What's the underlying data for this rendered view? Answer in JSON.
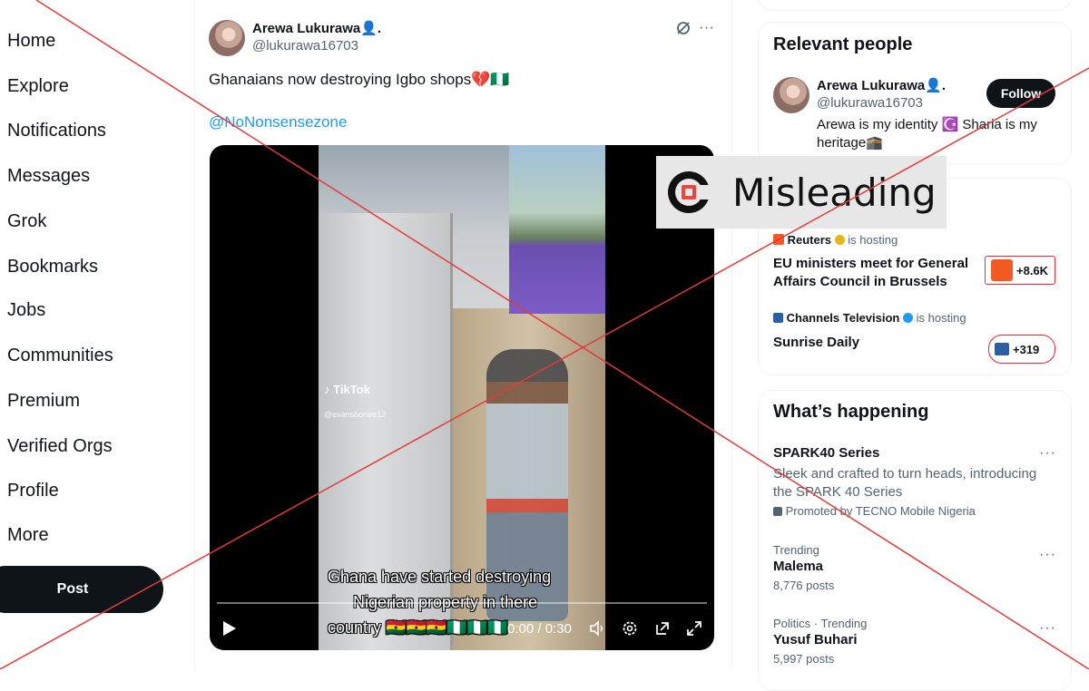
{
  "nav": {
    "items": [
      "Home",
      "Explore",
      "Notifications",
      "Messages",
      "Grok",
      "Bookmarks",
      "Jobs",
      "Communities",
      "Premium",
      "Verified Orgs",
      "Profile",
      "More"
    ],
    "post_label": "Post"
  },
  "tweet": {
    "author_name": "Arewa Lukurawa👤.",
    "author_handle": "@lukurawa16703",
    "text": "Ghanaians  now destroying Igbo shops💔🇳🇬",
    "mention": "@NoNonsensezone",
    "video": {
      "watermark": "TikTok",
      "watermark_user": "@evansbonee12",
      "caption_lines": [
        "Ghana have started destroying",
        "Nigerian property in there",
        "country 🇬🇭🇬🇭🇬🇭🇳🇬🇳🇬🇳🇬"
      ],
      "time": "0:00 / 0:30",
      "progress": 0
    }
  },
  "relevant": {
    "title": "Relevant people",
    "name": "Arewa Lukurawa👤.",
    "handle": "@lukurawa16703",
    "follow_label": "Follow",
    "bio_line1": "Arewa is my identity ☪️ Sharia is my",
    "bio_line2": "heritage🕋"
  },
  "spaces": [
    {
      "host": "Reuters",
      "hosting": "is hosting",
      "title_line1": "EU ministers meet for General",
      "title_line2": "Affairs Council in Brussels",
      "count": "+8.6K"
    },
    {
      "host": "Channels Television",
      "hosting": "is hosting",
      "title_line1": "Sunrise Daily",
      "title_line2": "",
      "count": "+319"
    }
  ],
  "happening": {
    "title": "What’s happening",
    "items": [
      {
        "context": "",
        "title": "SPARK40 Series",
        "desc_line1": "Sleek and crafted to turn heads, introducing",
        "desc_line2": "the SPARK 40 Series",
        "meta": "Promoted by TECNO Mobile Nigeria"
      },
      {
        "context": "Trending",
        "title": "Malema",
        "meta": "8,776 posts"
      },
      {
        "context": "Politics · Trending",
        "title": "Yusuf Buhari",
        "meta": "5,997 posts"
      }
    ]
  },
  "overlay": {
    "label": "Misleading",
    "color": "#e8463f"
  },
  "colors": {
    "accent": "#1d9bf0",
    "cross_lines": "#e23b3b",
    "space_border": "#f4212e"
  }
}
